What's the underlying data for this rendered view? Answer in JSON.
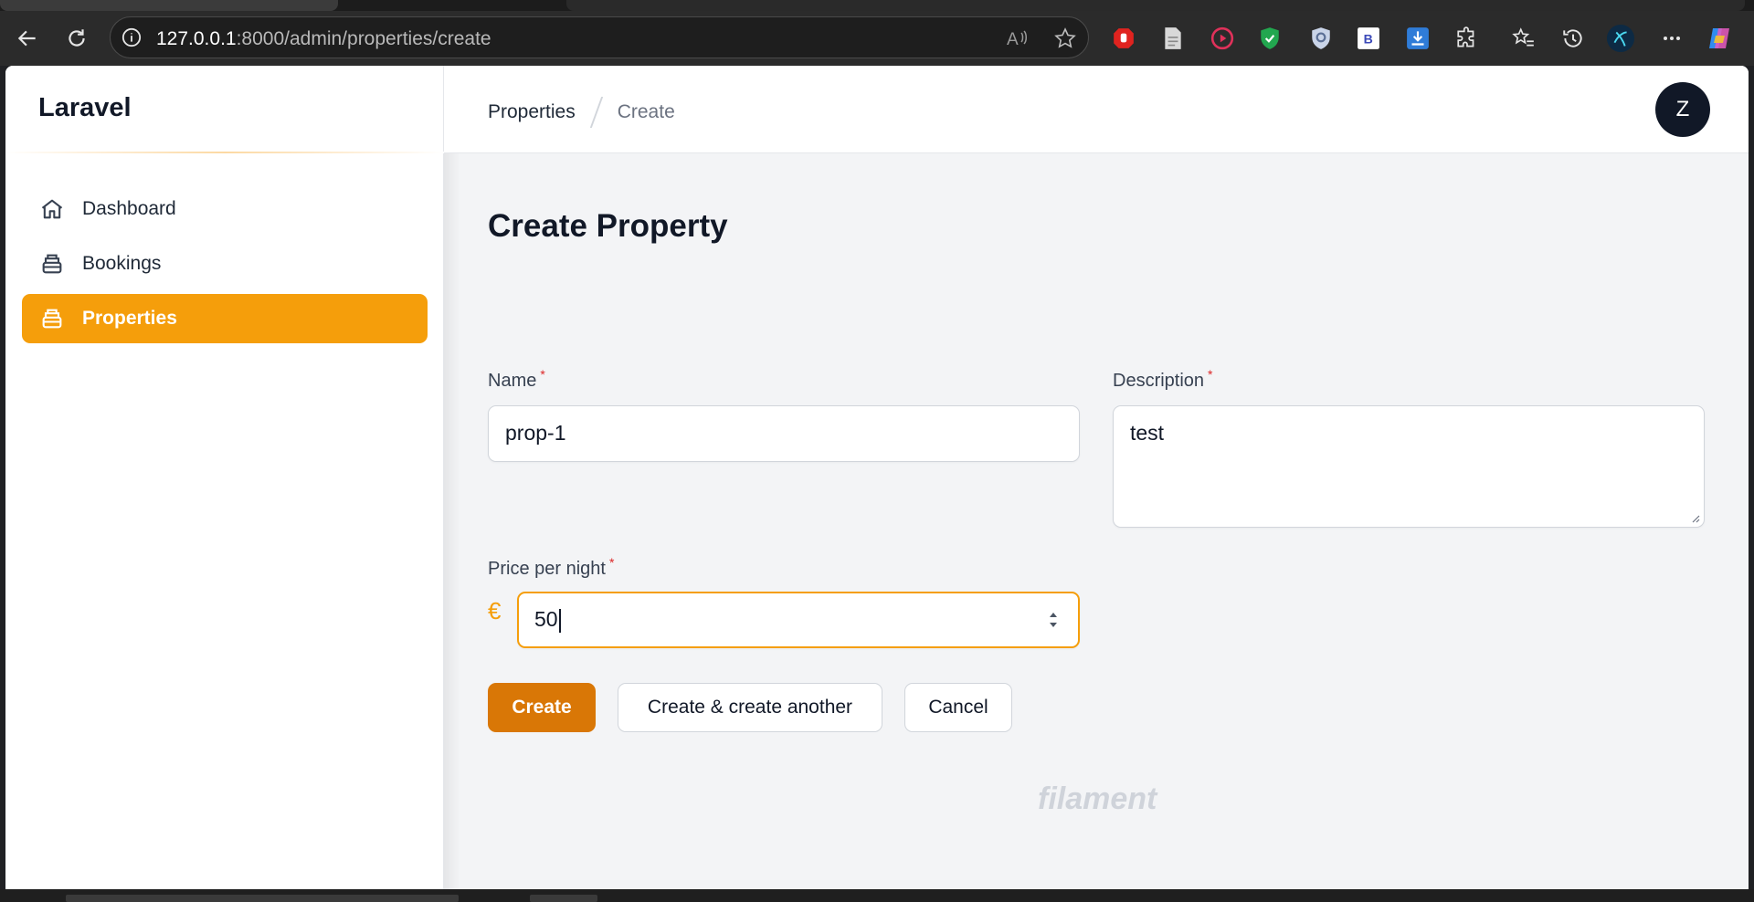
{
  "browser": {
    "url_host": "127.0.0.1",
    "url_path": ":8000/admin/properties/create"
  },
  "sidebar": {
    "brand": "Laravel",
    "items": [
      {
        "label": "Dashboard",
        "icon": "home-icon",
        "active": false
      },
      {
        "label": "Bookings",
        "icon": "bookings-icon",
        "active": false
      },
      {
        "label": "Properties",
        "icon": "properties-icon",
        "active": true
      }
    ]
  },
  "topbar": {
    "breadcrumbs": [
      "Properties",
      "Create"
    ],
    "avatar_initial": "Z"
  },
  "page": {
    "title": "Create Property"
  },
  "form": {
    "name": {
      "label": "Name",
      "required_marker": "*",
      "value": "prop-1"
    },
    "description": {
      "label": "Description",
      "required_marker": "*",
      "value": "test"
    },
    "price": {
      "label": "Price per night",
      "required_marker": "*",
      "prefix": "€",
      "value": "50"
    }
  },
  "actions": {
    "create": "Create",
    "create_another": "Create & create another",
    "cancel": "Cancel"
  },
  "footer": {
    "brand": "filament"
  },
  "colors": {
    "accent": "#f59e0b",
    "primary_button": "#d97706",
    "required": "#dc2626"
  }
}
